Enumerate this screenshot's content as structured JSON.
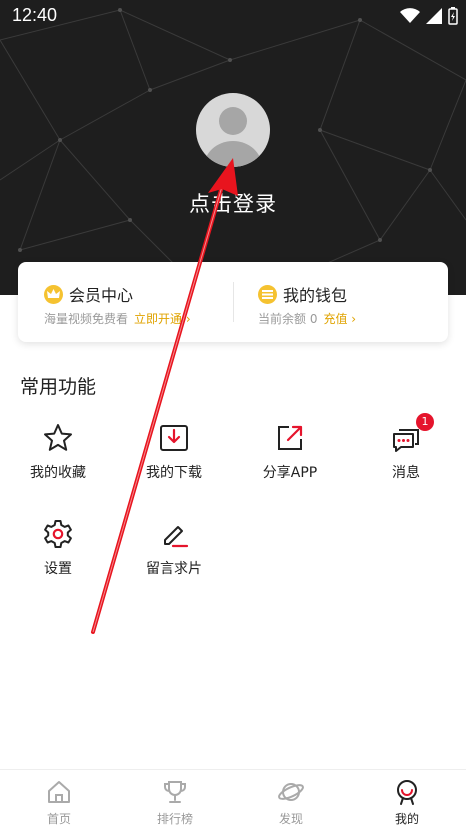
{
  "status_bar": {
    "time": "12:40"
  },
  "header": {
    "login_text": "点击登录"
  },
  "member_card": {
    "vip": {
      "title": "会员中心",
      "subtitle": "海量视频免费看",
      "action": "立即开通 ›"
    },
    "wallet": {
      "title": "我的钱包",
      "balance_label": "当前余额 0",
      "action": "充值 ›"
    }
  },
  "functions": {
    "title": "常用功能",
    "items": [
      {
        "label": "我的收藏",
        "icon": "star-icon"
      },
      {
        "label": "我的下载",
        "icon": "download-icon"
      },
      {
        "label": "分享APP",
        "icon": "share-icon"
      },
      {
        "label": "消息",
        "icon": "message-icon",
        "badge": "1"
      },
      {
        "label": "设置",
        "icon": "gear-icon"
      },
      {
        "label": "留言求片",
        "icon": "edit-icon"
      }
    ]
  },
  "tabbar": {
    "items": [
      {
        "label": "首页",
        "icon": "home-icon"
      },
      {
        "label": "排行榜",
        "icon": "trophy-icon"
      },
      {
        "label": "发现",
        "icon": "planet-icon"
      },
      {
        "label": "我的",
        "icon": "profile-icon",
        "active": true
      }
    ]
  },
  "colors": {
    "accent": "#e0a300",
    "badge": "#e5142c",
    "header_bg": "#1e1e1e",
    "annotation_arrow": "#e8141e"
  }
}
